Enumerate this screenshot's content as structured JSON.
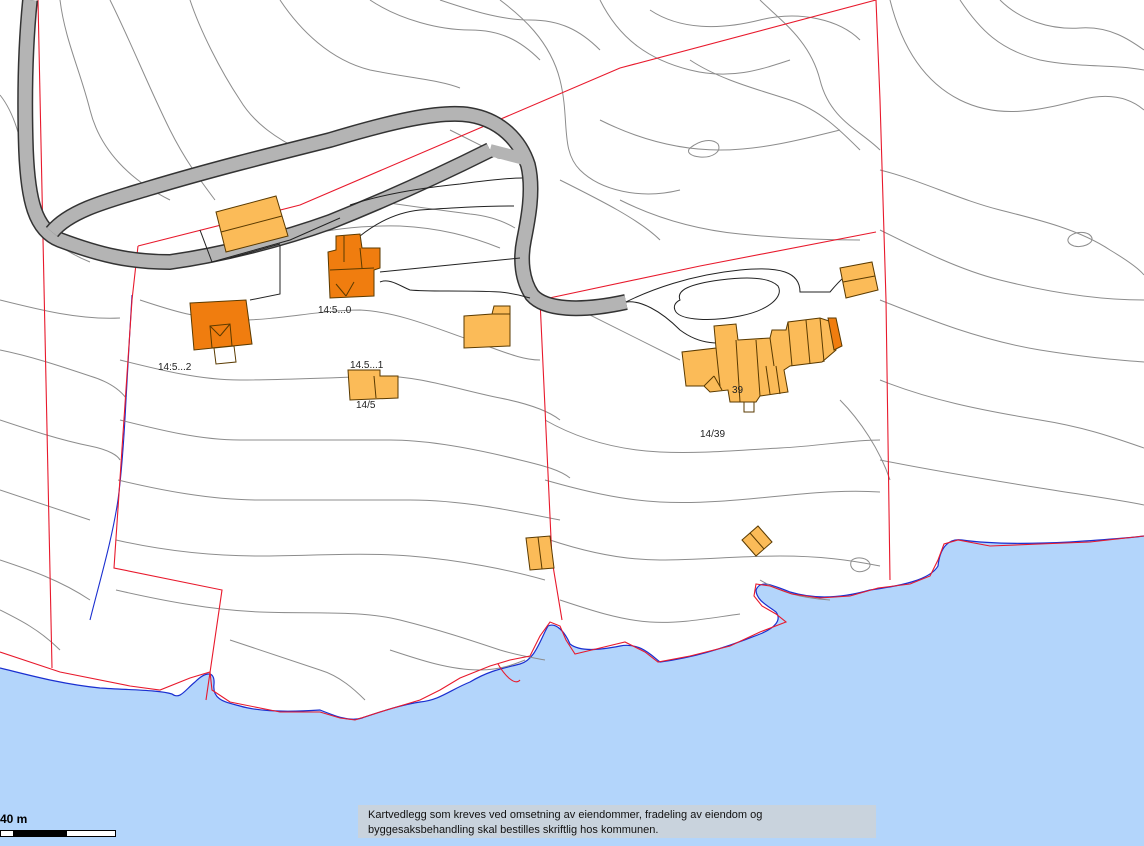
{
  "map": {
    "colors": {
      "sea": "#b3d5fb",
      "coastline": "#1a2fd0",
      "property_boundary": "#e8192c",
      "contour": "#8c8c8c",
      "road_fill": "#b4b4b4",
      "road_edge": "#333333",
      "building_main": "#f07d0f",
      "building_other": "#fbbb58",
      "building_outline": "#5a3a00"
    },
    "icons": [
      "north-up-map",
      "scale-bar"
    ]
  },
  "labels": {
    "parcel_14_5_0": "14:5...0",
    "parcel_14_5_2": "14:5...2",
    "parcel_14_5_1": "14.5...1",
    "parcel_14_5": "14/5",
    "house_39": "39",
    "parcel_14_39": "14/39"
  },
  "scale": {
    "text": "40 m"
  },
  "disclaimer": {
    "text": "Kartvedlegg som kreves ved omsetning av eiendommer, fradeling av eiendom og byggesaksbehandling skal bestilles skriftlig hos kommunen."
  }
}
